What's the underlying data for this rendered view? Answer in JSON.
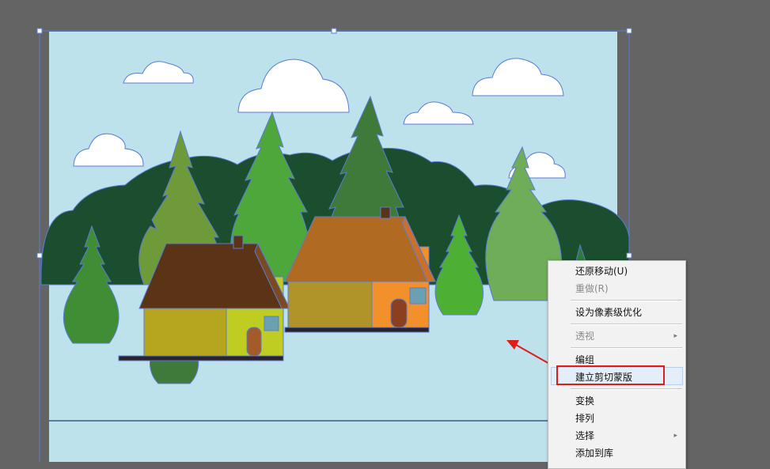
{
  "colors": {
    "workspace": "#646464",
    "artboard": "#bde2ec",
    "selection": "#5b7bd5",
    "annotation": "#e01b1b",
    "dark_tree": "#1b4e2e",
    "menu_bg": "#f2f2f2"
  },
  "context_menu": {
    "items": [
      {
        "label": "还原移动(U)",
        "enabled": true
      },
      {
        "label": "重做(R)",
        "enabled": false
      },
      {
        "label": "设为像素级优化",
        "enabled": true
      },
      {
        "label": "透视",
        "enabled": false,
        "submenu": true
      },
      {
        "label": "编组",
        "enabled": true
      },
      {
        "label": "建立剪切蒙版",
        "enabled": true,
        "highlighted": true
      },
      {
        "label": "变换",
        "enabled": true
      },
      {
        "label": "排列",
        "enabled": true
      },
      {
        "label": "选择",
        "enabled": true,
        "submenu": true
      },
      {
        "label": "添加到库",
        "enabled": true
      }
    ],
    "submenu_arrow": "▸"
  },
  "annotations": {
    "arrow_icon": "red-arrow-pointing-left",
    "box_target": "建立剪切蒙版"
  }
}
